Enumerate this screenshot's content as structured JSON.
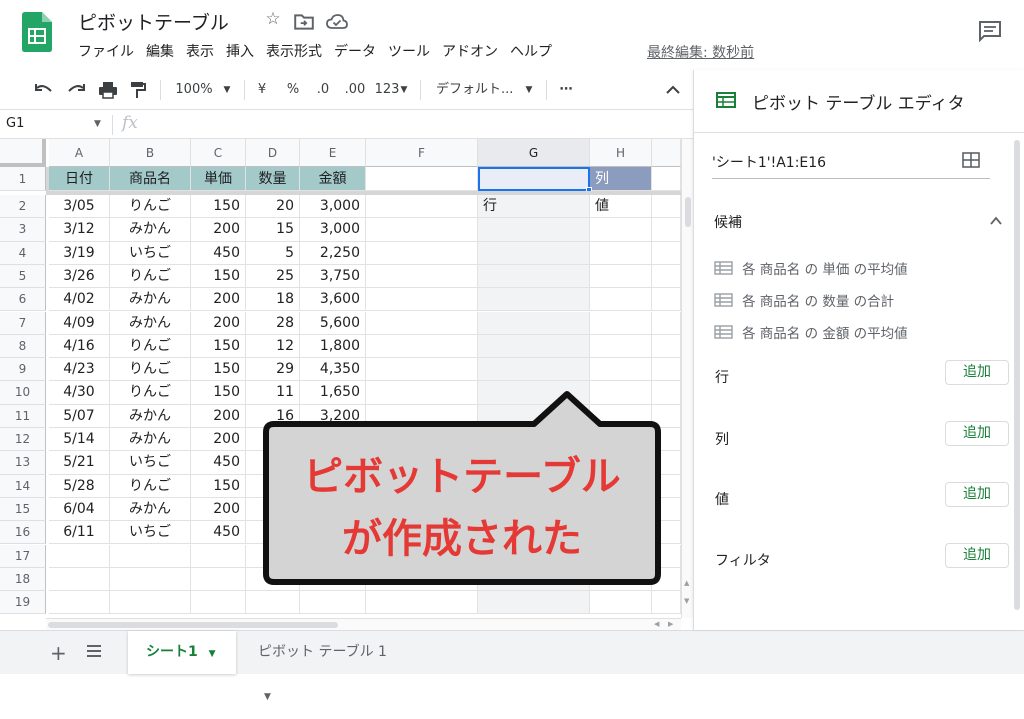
{
  "app": {
    "doc_title": "ピボットテーブル",
    "menu": [
      "ファイル",
      "編集",
      "表示",
      "挿入",
      "表示形式",
      "データ",
      "ツール",
      "アドオン",
      "ヘルプ"
    ],
    "last_edit": "最終編集: 数秒前"
  },
  "toolbar": {
    "zoom": "100%",
    "currency": "¥",
    "percent": "%",
    "dec_decrease": ".0",
    "dec_increase": ".00",
    "format_more": "123",
    "font": "デフォルト...",
    "more": "⋯"
  },
  "formula_bar": {
    "cell_ref": "G1",
    "fx": "fx"
  },
  "columns": [
    "A",
    "B",
    "C",
    "D",
    "E",
    "F",
    "G",
    "H"
  ],
  "rows": [
    "1",
    "2",
    "3",
    "4",
    "5",
    "6",
    "7",
    "8",
    "9",
    "10",
    "11",
    "12",
    "13",
    "14",
    "15",
    "16",
    "17",
    "18",
    "19"
  ],
  "table": {
    "headers": [
      "日付",
      "商品名",
      "単価",
      "数量",
      "金額"
    ],
    "rows": [
      [
        "3/05",
        "りんご",
        "150",
        "20",
        "3,000"
      ],
      [
        "3/12",
        "みかん",
        "200",
        "15",
        "3,000"
      ],
      [
        "3/19",
        "いちご",
        "450",
        "5",
        "2,250"
      ],
      [
        "3/26",
        "りんご",
        "150",
        "25",
        "3,750"
      ],
      [
        "4/02",
        "みかん",
        "200",
        "18",
        "3,600"
      ],
      [
        "4/09",
        "みかん",
        "200",
        "28",
        "5,600"
      ],
      [
        "4/16",
        "りんご",
        "150",
        "12",
        "1,800"
      ],
      [
        "4/23",
        "りんご",
        "150",
        "29",
        "4,350"
      ],
      [
        "4/30",
        "りんご",
        "150",
        "11",
        "1,650"
      ],
      [
        "5/07",
        "みかん",
        "200",
        "16",
        "3,200"
      ],
      [
        "5/14",
        "みかん",
        "200",
        "",
        ""
      ],
      [
        "5/21",
        "いちご",
        "450",
        "",
        ""
      ],
      [
        "5/28",
        "りんご",
        "150",
        "",
        ""
      ],
      [
        "6/04",
        "みかん",
        "200",
        "",
        ""
      ],
      [
        "6/11",
        "いちご",
        "450",
        "",
        ""
      ]
    ]
  },
  "pivot": {
    "col_label": "列",
    "row_label": "行",
    "value_label": "値"
  },
  "sheet_tabs": [
    "シート1",
    "ピボット テーブル 1"
  ],
  "editor": {
    "title": "ピボット テーブル エディタ",
    "range": "'シート1'!A1:E16",
    "suggestions_label": "候補",
    "suggestions": [
      "各 商品名 の 単価 の平均値",
      "各 商品名 の 数量 の合計",
      "各 商品名 の 金額 の平均値"
    ],
    "sections": [
      {
        "label": "行",
        "button": "追加"
      },
      {
        "label": "列",
        "button": "追加"
      },
      {
        "label": "値",
        "button": "追加"
      },
      {
        "label": "フィルタ",
        "button": "追加"
      }
    ]
  },
  "callout": {
    "line1": "ピボットテーブル",
    "line2": "が作成された",
    "text_color": "#e53935",
    "fill_color": "#d4d4d4"
  },
  "colors": {
    "header_fill": "#a3c9c9",
    "accent_green": "#188038",
    "pivot_header": "#8c9cbf"
  }
}
